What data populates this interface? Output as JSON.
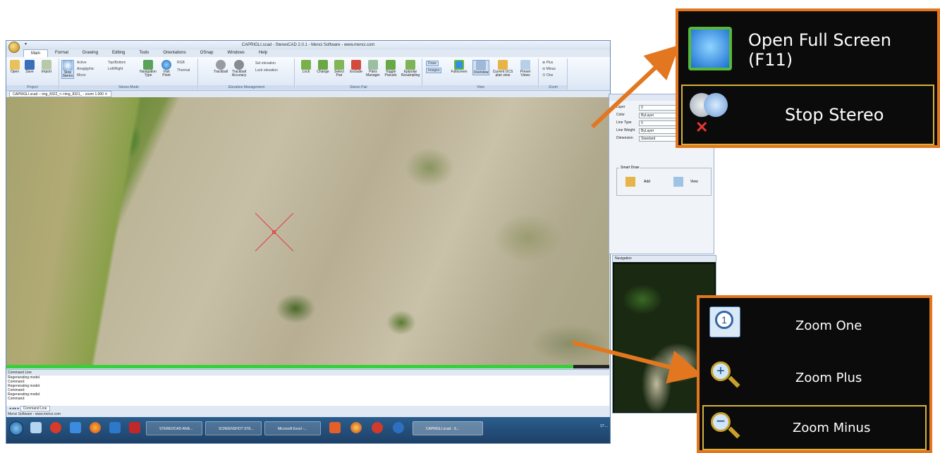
{
  "app": {
    "title": "CAPRIGLI.scad - StereoCAD 2.0.1 - Menci Software - www.menci.com",
    "quick_access": "▾",
    "tabs": [
      "Main",
      "Format",
      "Drawing",
      "Editing",
      "Tools",
      "Orientations",
      "OSnap",
      "Windows",
      "Help"
    ],
    "ribbon": {
      "project": {
        "label": "Project",
        "open": "Open",
        "save": "Save",
        "import": "Import"
      },
      "stereo_mode": {
        "label": "Stereo Mode",
        "stop_stereo": "Stop Stereo",
        "active": "Active",
        "anaglyphic": "Anaglyphic",
        "mono": "Mono",
        "top_bottom": "Top/Bottom",
        "left_right": "Left/Right",
        "navigation_type": "Navigation Type",
        "visit_point": "Visit Point",
        "rgb": "RGB",
        "thermal": "Thermal"
      },
      "elevation": {
        "label": "Elevation Management",
        "trackball": "Trackball",
        "trackball_accuracy": "Trackball Accuracy",
        "set_elevation": "Set elevation",
        "lock_elevation": "Lock elevation"
      },
      "stereo_pair": {
        "label": "Stereo Pair",
        "lock": "Lock",
        "change": "Change",
        "select_pair": "Select Pair",
        "exclude": "Exclude",
        "pairs_manager": "Pairs Manager",
        "toggle_pseudo": "Toggle Pseudo",
        "epipolar_resampling": "Epipolar Resampling"
      },
      "view": {
        "label": "View",
        "draw": "Draw",
        "images": "Images",
        "fullscreen": "Fullscreen",
        "overview": "Overview",
        "current_ucs": "Current UCS plan view",
        "preset_views": "Preset Views"
      },
      "zoom": {
        "label": "Zoom",
        "plus": "Plus",
        "minus": "Minus",
        "one": "One"
      }
    },
    "document_tab": "CAPRIGLI.scad -- img_8322_<->img_8321_ - zoom 1.000",
    "progress": 0.94,
    "command_panel": {
      "title": "Command Line",
      "lines": [
        "Regenerating model.",
        "Command:",
        "Regenerating model.",
        "Command:",
        "Regenerating model.",
        "Command:"
      ],
      "tab": "Command Line"
    },
    "status": "Menci Software - www.menci.com",
    "properties": {
      "layer_label": "Layer",
      "layer_value": "0",
      "color_label": "Color",
      "color_value": "ByLayer",
      "linetype_label": "Line Type",
      "linetype_value": "0",
      "lineweight_label": "Line Weight",
      "lineweight_value": "ByLayer",
      "dimension_label": "Dimension",
      "dimension_value": "Standard",
      "smart_draw": "Smart Draw",
      "add": "Add",
      "view": "View"
    },
    "navigation_title": "Navigation",
    "taskbar": {
      "windows": [
        "STEREOCAD-ANA...",
        "SCREENSHOT STE...",
        "Microsoft Excel -...",
        "CAPRIGLI.scad - S..."
      ],
      "clock": "17:..."
    }
  },
  "callouts": {
    "top": {
      "full_screen": "Open Full Screen (F11)",
      "stop_stereo": "Stop Stereo"
    },
    "bottom": {
      "zoom_one": "Zoom One",
      "zoom_plus": "Zoom Plus",
      "zoom_minus": "Zoom Minus"
    }
  },
  "colors": {
    "callout_border": "#e3771f",
    "callout_bg": "#0b0b0b",
    "highlight_frame": "#d8b23c",
    "crosshair": "#e04040",
    "progress": "#33d13a"
  }
}
